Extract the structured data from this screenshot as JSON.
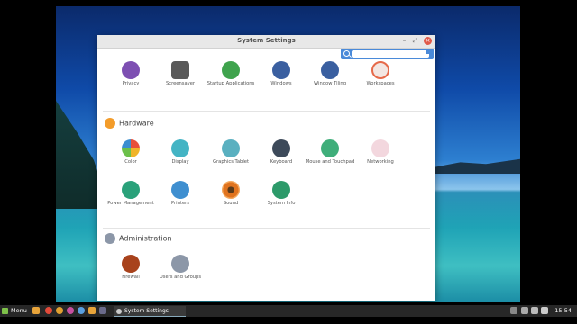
{
  "window": {
    "title": "System Settings"
  },
  "search": {
    "value": ""
  },
  "top_row": [
    {
      "label": "Privacy",
      "color": "#7d4fb2"
    },
    {
      "label": "Screensaver",
      "color": "#5a5a5a"
    },
    {
      "label": "Startup Applications",
      "color": "#3fa34d"
    },
    {
      "label": "Windows",
      "color": "#3a5fa0"
    },
    {
      "label": "Window Tiling",
      "color": "#3a5fa0"
    },
    {
      "label": "Workspaces",
      "color": "#e66a4a"
    }
  ],
  "hardware": {
    "title": "Hardware",
    "items": [
      {
        "label": "Color",
        "color": "#f0b429"
      },
      {
        "label": "Display",
        "color": "#44b4c4"
      },
      {
        "label": "Graphics Tablet",
        "color": "#5ab0c0"
      },
      {
        "label": "Keyboard",
        "color": "#3d4a5a"
      },
      {
        "label": "Mouse and Touchpad",
        "color": "#3fae7a"
      },
      {
        "label": "Networking",
        "color": "#e06a8a"
      },
      {
        "label": "Power Management",
        "color": "#2aa17a"
      },
      {
        "label": "Printers",
        "color": "#3f8fd0"
      },
      {
        "label": "Sound",
        "color": "#e0731e"
      },
      {
        "label": "System Info",
        "color": "#2d9a6a"
      }
    ]
  },
  "administration": {
    "title": "Administration",
    "items": [
      {
        "label": "Firewall",
        "color": "#a8421c"
      },
      {
        "label": "Users and Groups",
        "color": "#8c97a8"
      }
    ]
  },
  "panel": {
    "menu_label": "Menu",
    "task_label": "System Settings",
    "clock": "15:54"
  }
}
